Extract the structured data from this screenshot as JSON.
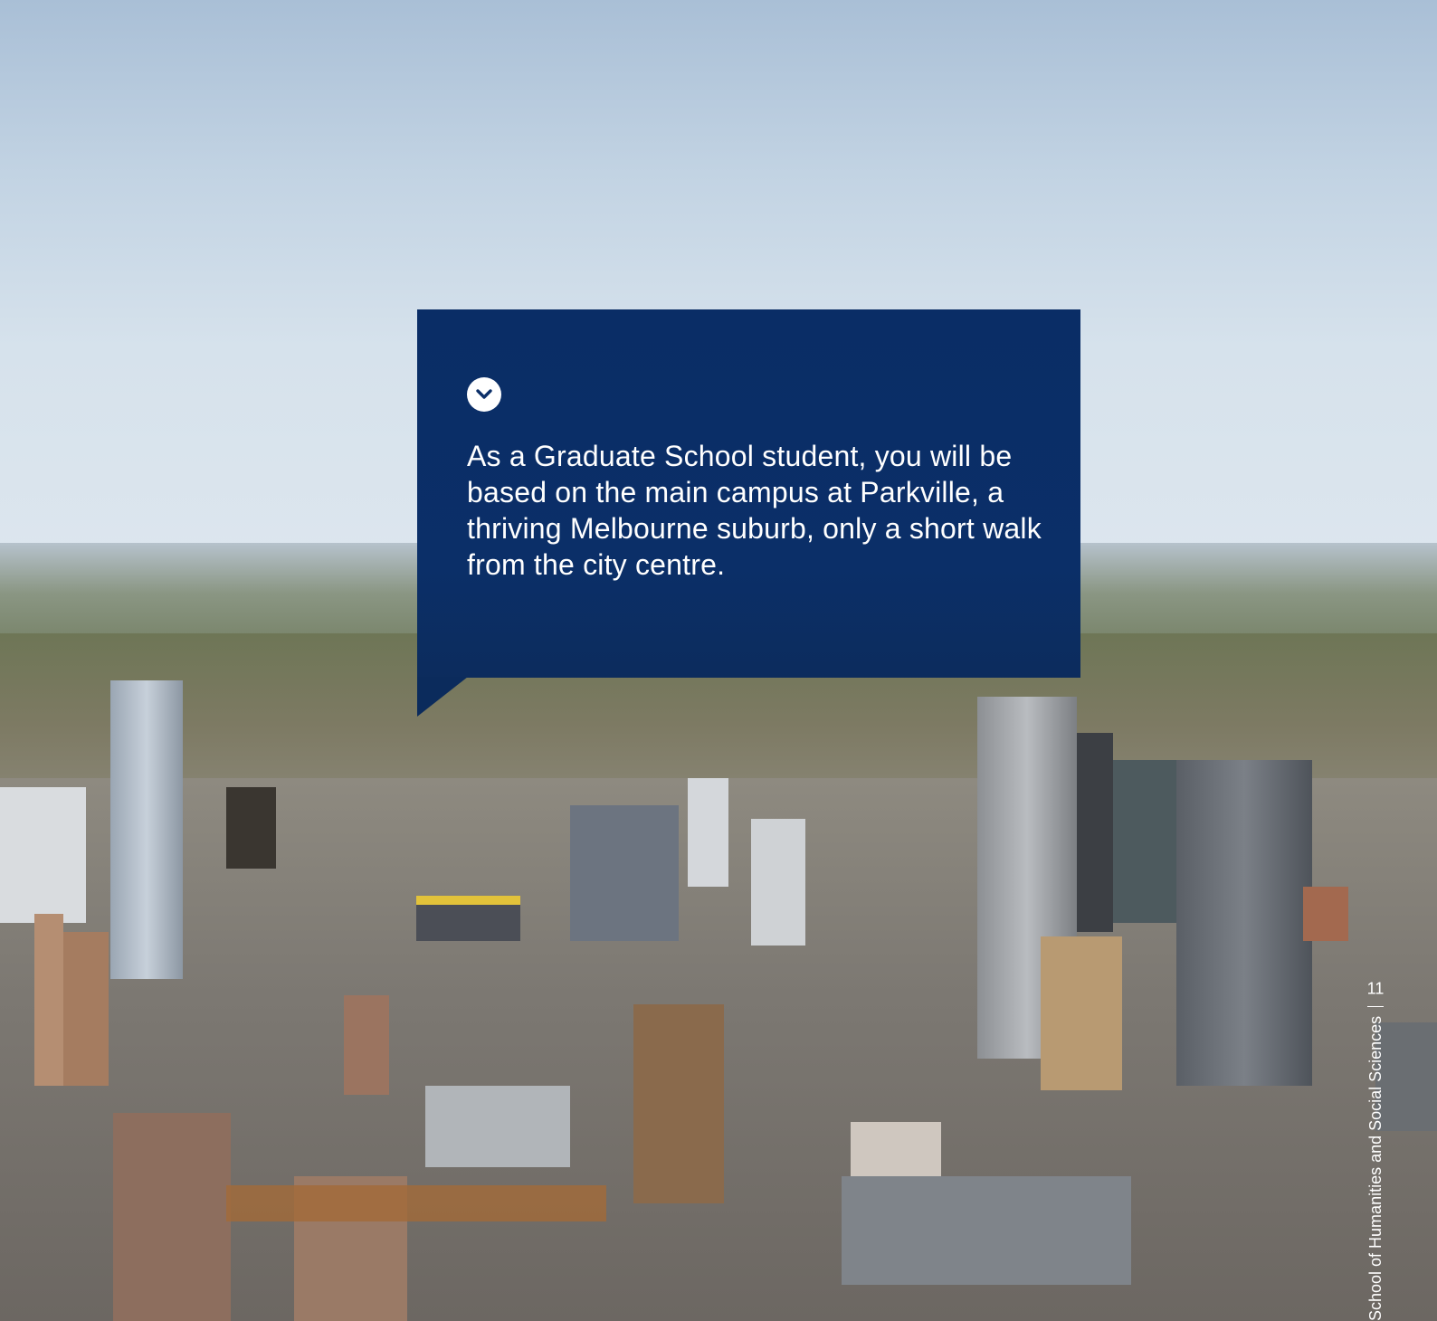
{
  "callout": {
    "text": "As a Graduate School student, you will be based on the main campus at Parkville, a thriving Melbourne suburb, only a short walk from the city centre.",
    "icon": "chevron-down-circle-icon",
    "background_color": "#0b2f68",
    "text_color": "#ffffff"
  },
  "footer": {
    "school_name": "School of Humanities and Social Sciences",
    "page_number": "11"
  },
  "photo": {
    "subject": "city-skyline-photo"
  }
}
